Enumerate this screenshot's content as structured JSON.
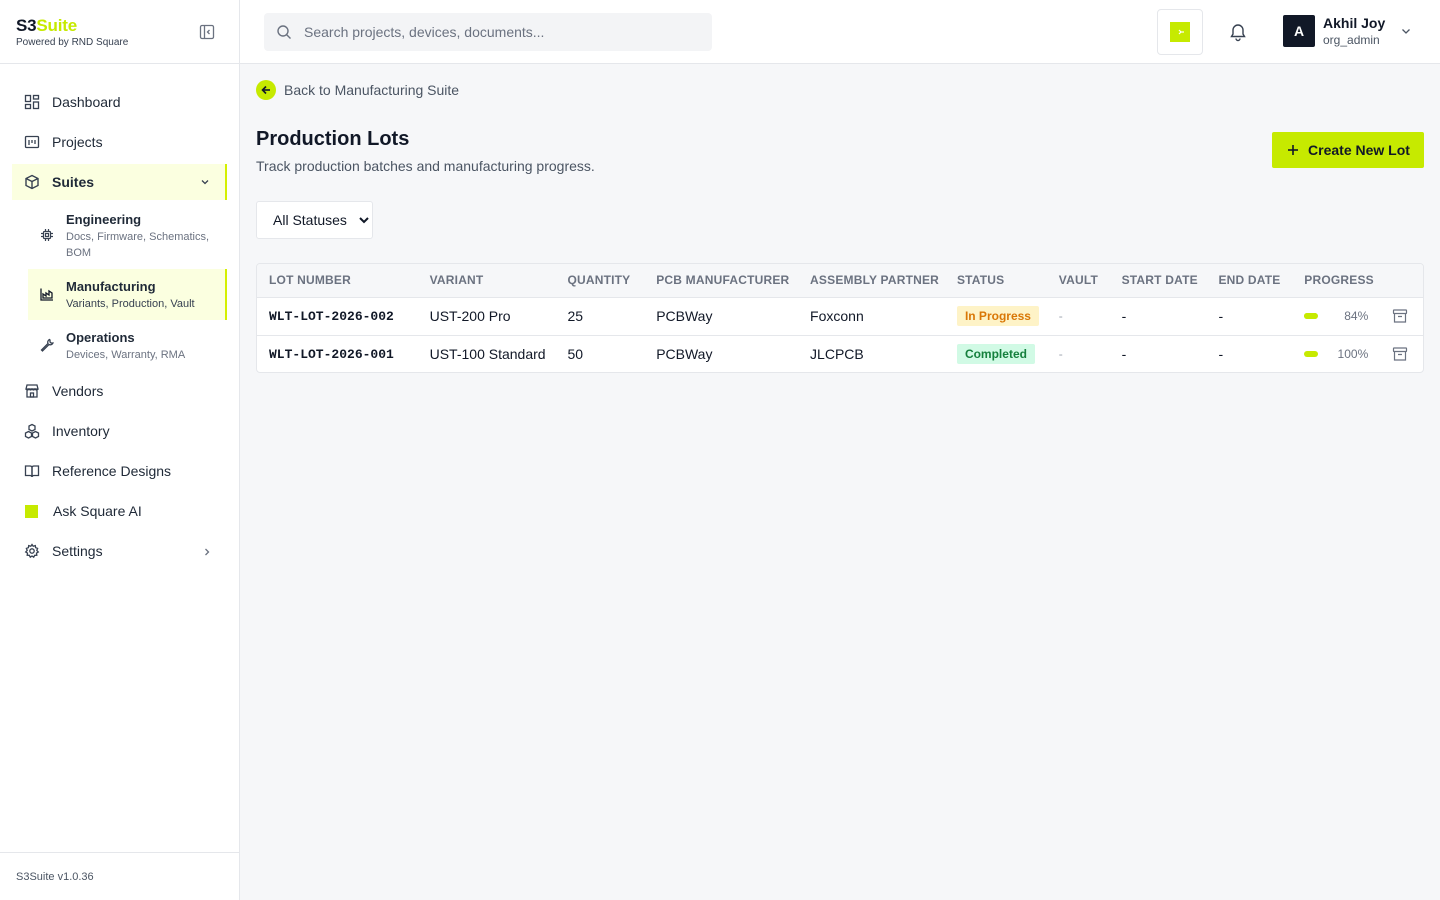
{
  "brand": {
    "name_a": "S3",
    "name_b": "Suite",
    "tagline": "Powered by RND Square"
  },
  "sidebar": {
    "dashboard": "Dashboard",
    "projects": "Projects",
    "suites": "Suites",
    "engineering": {
      "title": "Engineering",
      "desc": "Docs, Firmware, Schematics, BOM"
    },
    "manufacturing": {
      "title": "Manufacturing",
      "desc": "Variants, Production, Vault"
    },
    "operations": {
      "title": "Operations",
      "desc": "Devices, Warranty, RMA"
    },
    "vendors": "Vendors",
    "inventory": "Inventory",
    "reference": "Reference Designs",
    "ai": "Ask Square AI",
    "settings": "Settings",
    "version": "S3Suite v1.0.36"
  },
  "header": {
    "search_placeholder": "Search projects, devices, documents...",
    "user_initial": "A",
    "user_name": "Akhil Joy",
    "user_role": "org_admin"
  },
  "page": {
    "back": "Back to Manufacturing Suite",
    "title": "Production Lots",
    "subtitle": "Track production batches and manufacturing progress.",
    "create": "Create New Lot",
    "filter": "All Statuses"
  },
  "table": {
    "headers": [
      "LOT NUMBER",
      "VARIANT",
      "QUANTITY",
      "PCB MANUFACTURER",
      "ASSEMBLY PARTNER",
      "STATUS",
      "VAULT",
      "START DATE",
      "END DATE",
      "PROGRESS"
    ],
    "rows": [
      {
        "lot": "WLT-LOT-2026-002",
        "variant": "UST-200 Pro",
        "qty": "25",
        "pcb": "PCBWay",
        "assembly": "Foxconn",
        "status": "In Progress",
        "vault": "-",
        "start": "-",
        "end": "-",
        "progress": "84%"
      },
      {
        "lot": "WLT-LOT-2026-001",
        "variant": "UST-100 Standard",
        "qty": "50",
        "pcb": "PCBWay",
        "assembly": "JLCPCB",
        "status": "Completed",
        "vault": "-",
        "start": "-",
        "end": "-",
        "progress": "100%"
      }
    ]
  },
  "colors": {
    "accent": "#c6ea00",
    "in_progress_bg": "#fef3c7",
    "in_progress_fg": "#d97706",
    "completed_bg": "#d1fae5",
    "completed_fg": "#15803d"
  }
}
